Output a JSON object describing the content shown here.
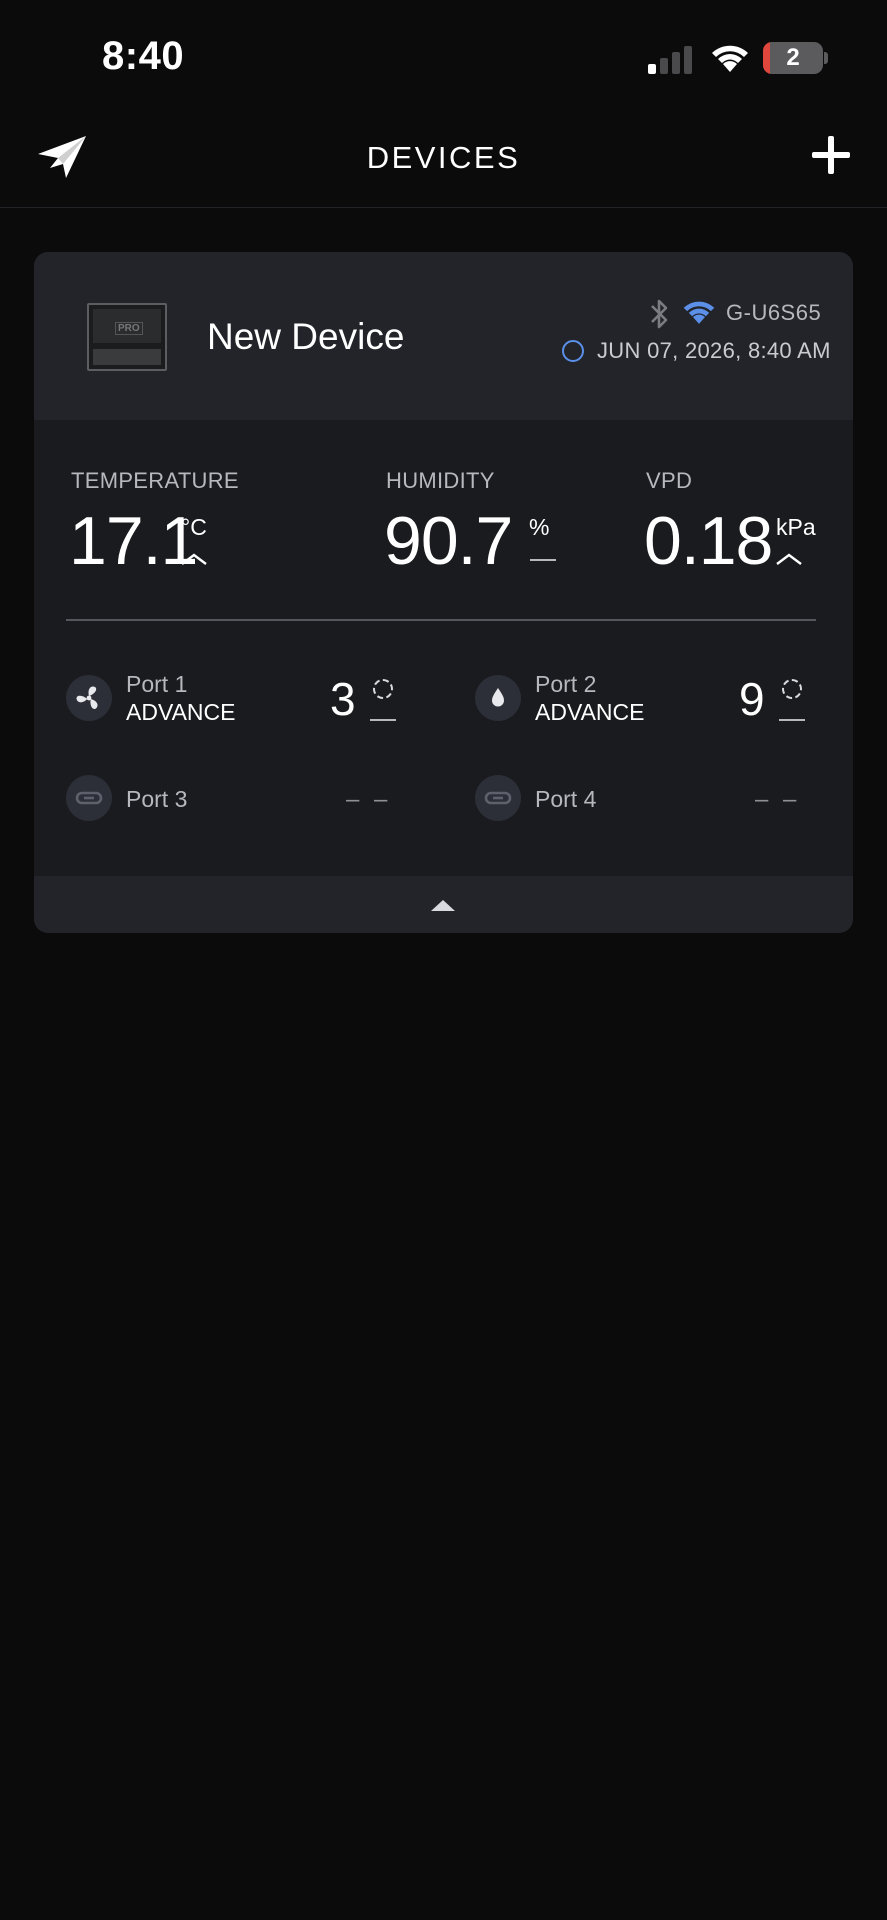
{
  "status_bar": {
    "time": "8:40",
    "battery": "2"
  },
  "nav": {
    "title": "DEVICES"
  },
  "device": {
    "name": "New Device",
    "thumb_label": "PRO",
    "id": "G-U6S65",
    "timestamp": "JUN 07, 2026, 8:40 AM",
    "colors": {
      "wifi": "#5b8fe8",
      "bluetooth": "#7a7c80",
      "status_ring": "#5b8fe8"
    }
  },
  "metrics": {
    "temperature": {
      "label": "TEMPERATURE",
      "value": "17.1",
      "unit": "°C",
      "trend": "up"
    },
    "humidity": {
      "label": "HUMIDITY",
      "value": "90.7",
      "unit": "%",
      "trend": "flat"
    },
    "vpd": {
      "label": "VPD",
      "value": "0.18",
      "unit": "kPa",
      "trend": "up"
    }
  },
  "ports": [
    {
      "name": "Port 1",
      "mode": "ADVANCE",
      "level": "3",
      "icon": "fan-icon"
    },
    {
      "name": "Port 2",
      "mode": "ADVANCE",
      "level": "9",
      "icon": "water-drop-icon"
    },
    {
      "name": "Port 3",
      "mode": "",
      "level": "– –",
      "icon": "link-icon"
    },
    {
      "name": "Port 4",
      "mode": "",
      "level": "– –",
      "icon": "link-icon"
    }
  ]
}
